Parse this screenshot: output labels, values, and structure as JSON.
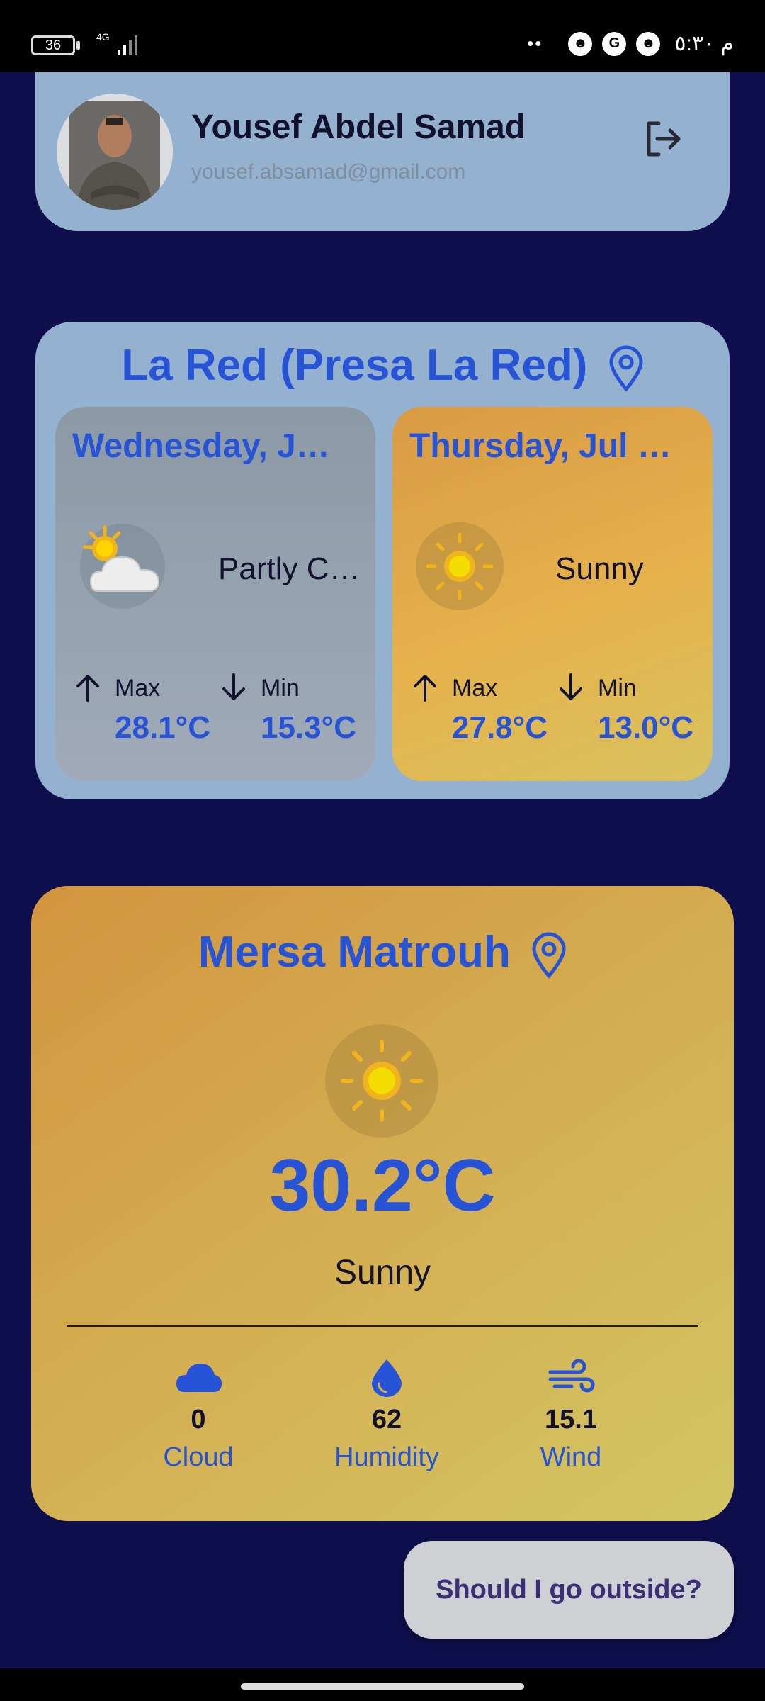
{
  "status_bar": {
    "battery": "36",
    "network": "4G",
    "dots": "••",
    "time": "م ٥:٣٠"
  },
  "profile": {
    "name": "Yousef Abdel Samad",
    "email": "yousef.absamad@gmail.com",
    "icons": {
      "avatar": "user-photo",
      "logout": "logout-icon"
    }
  },
  "city_forecast": {
    "title": "La Red (Presa La Red)",
    "days": [
      {
        "date": "Wednesday, J…",
        "condition": "Partly C…",
        "icon": "partly-cloudy-icon",
        "max_label": "Max",
        "max": "28.1°C",
        "min_label": "Min",
        "min": "15.3°C"
      },
      {
        "date": "Thursday, Jul …",
        "condition": "Sunny",
        "icon": "sun-icon",
        "max_label": "Max",
        "max": "27.8°C",
        "min_label": "Min",
        "min": "13.0°C"
      }
    ]
  },
  "current": {
    "city": "Mersa Matrouh",
    "temperature": "30.2°C",
    "condition": "Sunny",
    "stats": [
      {
        "value": "0",
        "label": "Cloud",
        "icon": "cloud-icon"
      },
      {
        "value": "62",
        "label": "Humidity",
        "icon": "droplet-icon"
      },
      {
        "value": "15.1",
        "label": "Wind",
        "icon": "wind-icon"
      }
    ]
  },
  "fab": {
    "label": "Should I go outside?"
  },
  "colors": {
    "background": "#0f0f4e",
    "card": "#94b2d0",
    "accent": "#2754d6",
    "sunny_gradient_start": "#d2953e",
    "sunny_gradient_end": "#d2c662"
  }
}
